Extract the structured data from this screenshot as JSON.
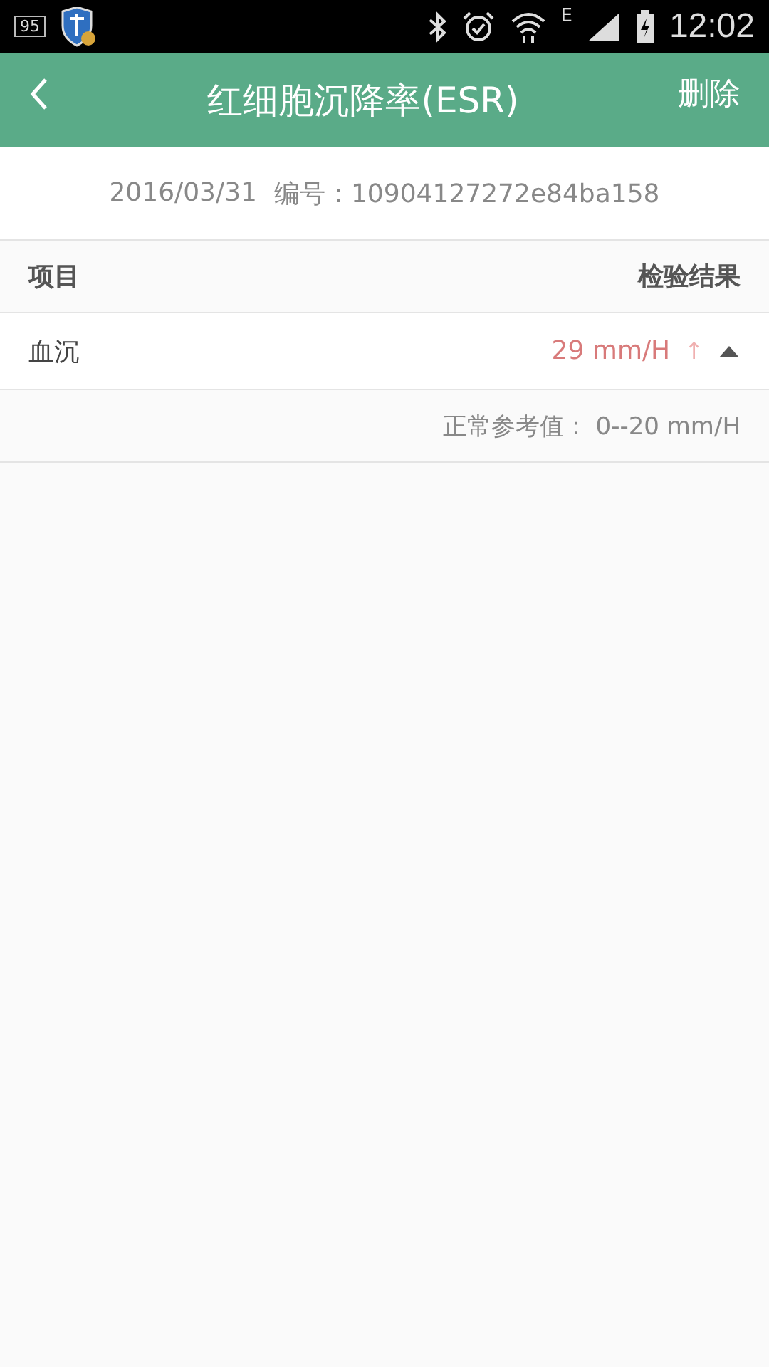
{
  "status_bar": {
    "notification_badge": "95",
    "network": "E",
    "time": "12:02"
  },
  "app_bar": {
    "title": "红细胞沉降率(ESR)",
    "action": "删除"
  },
  "report": {
    "date": "2016/03/31",
    "number_label": "编号：",
    "number": "10904127272e84ba158"
  },
  "table": {
    "columns": [
      "项目",
      "检验结果"
    ],
    "rows": [
      {
        "item": "血沉",
        "result": "29 mm/H",
        "flag": "↑",
        "expanded": true,
        "reference_label": "正常参考值：",
        "reference": "0--20 mm/H"
      }
    ]
  }
}
